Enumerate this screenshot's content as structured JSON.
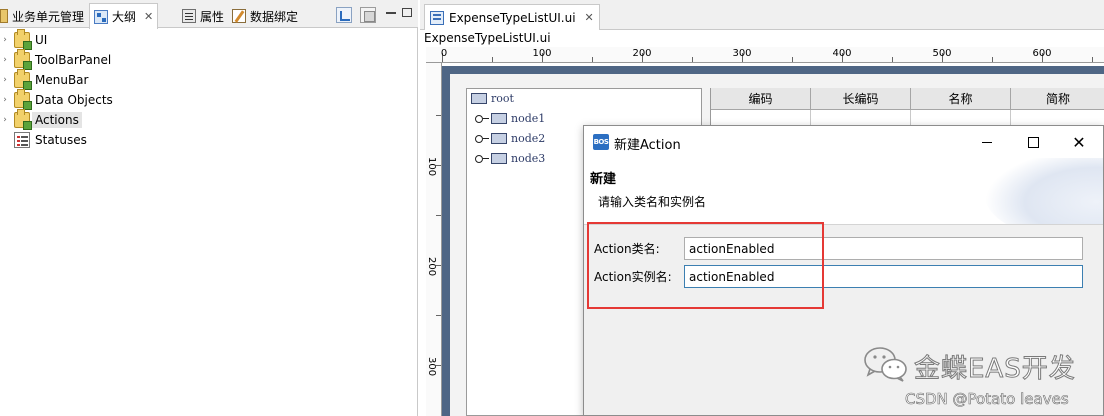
{
  "left_panel": {
    "tabs": [
      {
        "label": "业务单元管理",
        "icon": "business-unit-icon"
      },
      {
        "label": "大纲",
        "icon": "outline-icon"
      },
      {
        "label": "属性",
        "icon": "properties-icon"
      },
      {
        "label": "数据绑定",
        "icon": "data-binding-icon"
      }
    ],
    "close_glyph": "✕",
    "tree": [
      {
        "label": "UI",
        "icon": "package-icon",
        "expandable": true
      },
      {
        "label": "ToolBarPanel",
        "icon": "package-icon",
        "expandable": true
      },
      {
        "label": "MenuBar",
        "icon": "package-icon",
        "expandable": true
      },
      {
        "label": "Data Objects",
        "icon": "package-icon",
        "expandable": true
      },
      {
        "label": "Actions",
        "icon": "package-icon",
        "expandable": true,
        "selected": true
      },
      {
        "label": "Statuses",
        "icon": "list-icon",
        "expandable": false
      }
    ]
  },
  "editor": {
    "tab_label": "ExpenseTypeListUI.ui",
    "close_glyph": "✕",
    "breadcrumb": "ExpenseTypeListUI.ui",
    "ruler_top": [
      "0",
      "100",
      "200",
      "300",
      "400",
      "500",
      "600"
    ],
    "ruler_left": [
      "100",
      "200",
      "300"
    ],
    "ui_tree": {
      "root": "root",
      "nodes": [
        "node1",
        "node2",
        "node3"
      ]
    },
    "grid_columns": [
      "编码",
      "长编码",
      "名称",
      "简称"
    ]
  },
  "dialog": {
    "icon_text": "BOS",
    "title": "新建Action",
    "close_glyph": "✕",
    "header_title": "新建",
    "header_message": "请输入类名和实例名",
    "fields": {
      "class_name_label": "Action类名:",
      "class_name_value": "actionEnabled",
      "instance_name_label": "Action实例名:",
      "instance_name_value": "actionEnabled"
    },
    "highlight_color": "#e53935"
  },
  "watermark": {
    "brand": "金蝶EAS开发",
    "csdn": "CSDN @Potato leaves"
  }
}
